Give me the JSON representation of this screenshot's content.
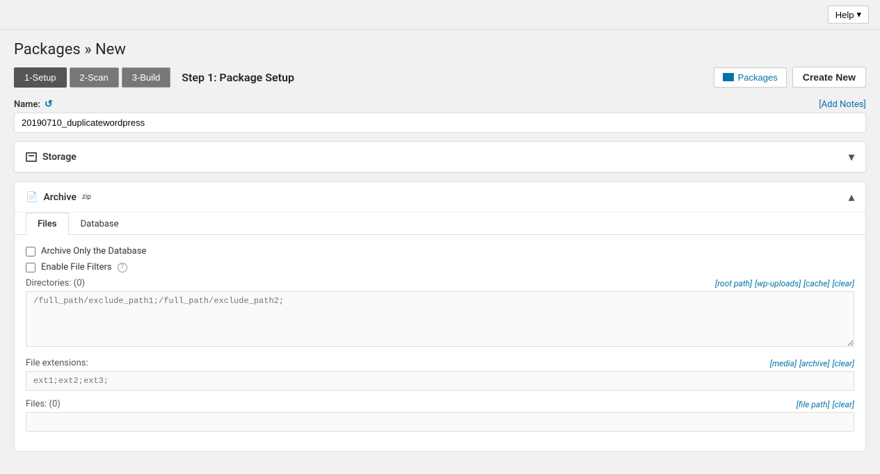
{
  "topbar": {
    "help_label": "Help"
  },
  "page": {
    "title": "Packages » New"
  },
  "steps": [
    {
      "id": "step-1",
      "label": "1-Setup",
      "active": true
    },
    {
      "id": "step-2",
      "label": "2-Scan",
      "active": false
    },
    {
      "id": "step-3",
      "label": "3-Build",
      "active": false
    }
  ],
  "step_heading": "Step 1: Package Setup",
  "actions": {
    "packages_label": "Packages",
    "create_new_label": "Create New"
  },
  "name_section": {
    "label": "Name:",
    "add_notes_label": "[Add Notes]",
    "value": "20190710_duplicatewordpress"
  },
  "storage_panel": {
    "title": "Storage",
    "collapsed": true
  },
  "archive_panel": {
    "title": "Archive",
    "superscript": "zip",
    "collapsed": false,
    "tabs": [
      {
        "id": "files",
        "label": "Files",
        "active": true
      },
      {
        "id": "database",
        "label": "Database",
        "active": false
      }
    ],
    "archive_only_db_label": "Archive Only the Database",
    "enable_file_filters_label": "Enable File Filters",
    "directories": {
      "label": "Directories:",
      "count": "(0)",
      "links": [
        "[root path]",
        "[wp-uploads]",
        "[cache]",
        "[clear]"
      ],
      "placeholder": "/full_path/exclude_path1;/full_path/exclude_path2;"
    },
    "file_extensions": {
      "label": "File extensions:",
      "links": [
        "[media]",
        "[archive]",
        "[clear]"
      ],
      "placeholder": "ext1;ext2;ext3;"
    },
    "files": {
      "label": "Files:",
      "count": "(0)",
      "links": [
        "[file path]",
        "[clear]"
      ]
    }
  }
}
